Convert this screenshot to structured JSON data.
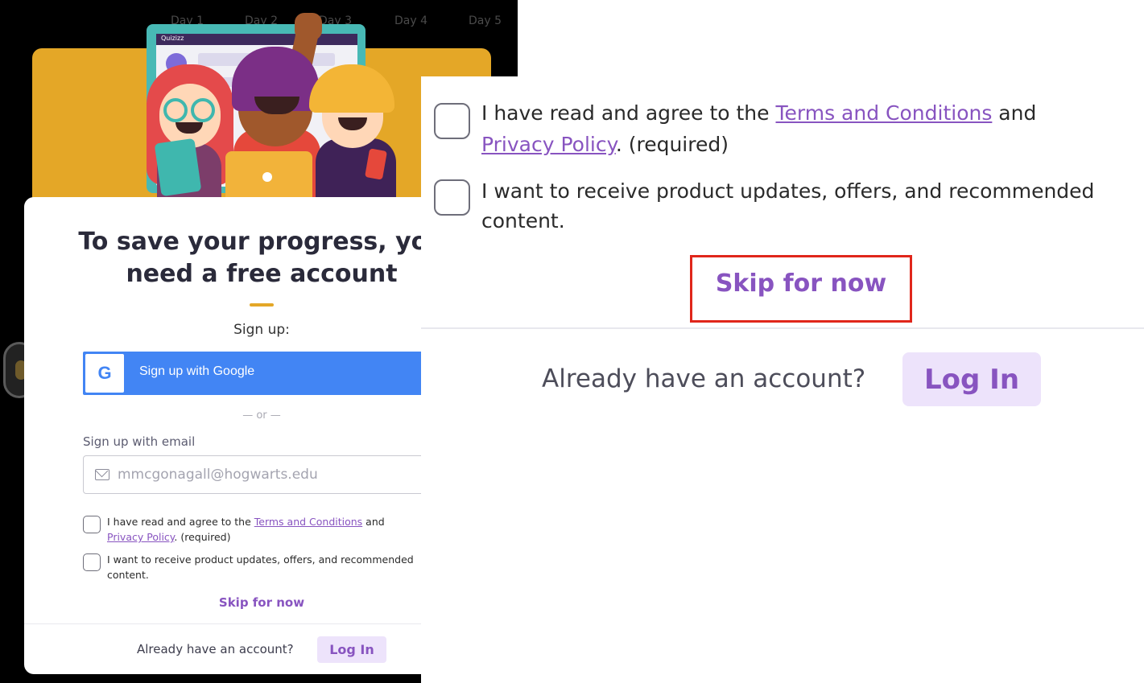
{
  "background_app": {
    "days": [
      "Day 1",
      "Day 2",
      "Day 3",
      "Day 4",
      "Day 5"
    ],
    "illustration_app_name": "Quizizz"
  },
  "signup_card": {
    "title": "To save your progress, you need a free account",
    "signup_label": "Sign up:",
    "google_button_label": "Sign up with Google",
    "google_icon_letter": "G",
    "or_divider": "— or —",
    "email_label": "Sign up with email",
    "email_placeholder": "mmcgonagall@hogwarts.edu",
    "terms": {
      "prefix": "I have read and agree to the ",
      "terms_link": "Terms and Conditions",
      "middle": " and",
      "privacy_link": "Privacy Policy",
      "suffix": ". (required)"
    },
    "updates": {
      "line1": "I want to receive product updates, offers, and recommended",
      "line2": "content."
    },
    "skip_label": "Skip for now",
    "already_text": "Already have an account?",
    "login_label": "Log In"
  },
  "zoom_panel": {
    "terms": {
      "prefix": "I have read and agree to the ",
      "terms_link": "Terms and Conditions",
      "middle": " and",
      "privacy_link": "Privacy Policy",
      "suffix": ". (required)"
    },
    "updates": {
      "line1": "I want to receive product updates, offers, and recommended",
      "line2": "content."
    },
    "skip_label": "Skip for now",
    "already_text": "Already have an account?",
    "login_label": "Log In"
  },
  "colors": {
    "brand_purple": "#8854c0",
    "google_blue": "#4285f4",
    "banner_yellow": "#e4a727",
    "highlight_red": "#e0261b"
  }
}
